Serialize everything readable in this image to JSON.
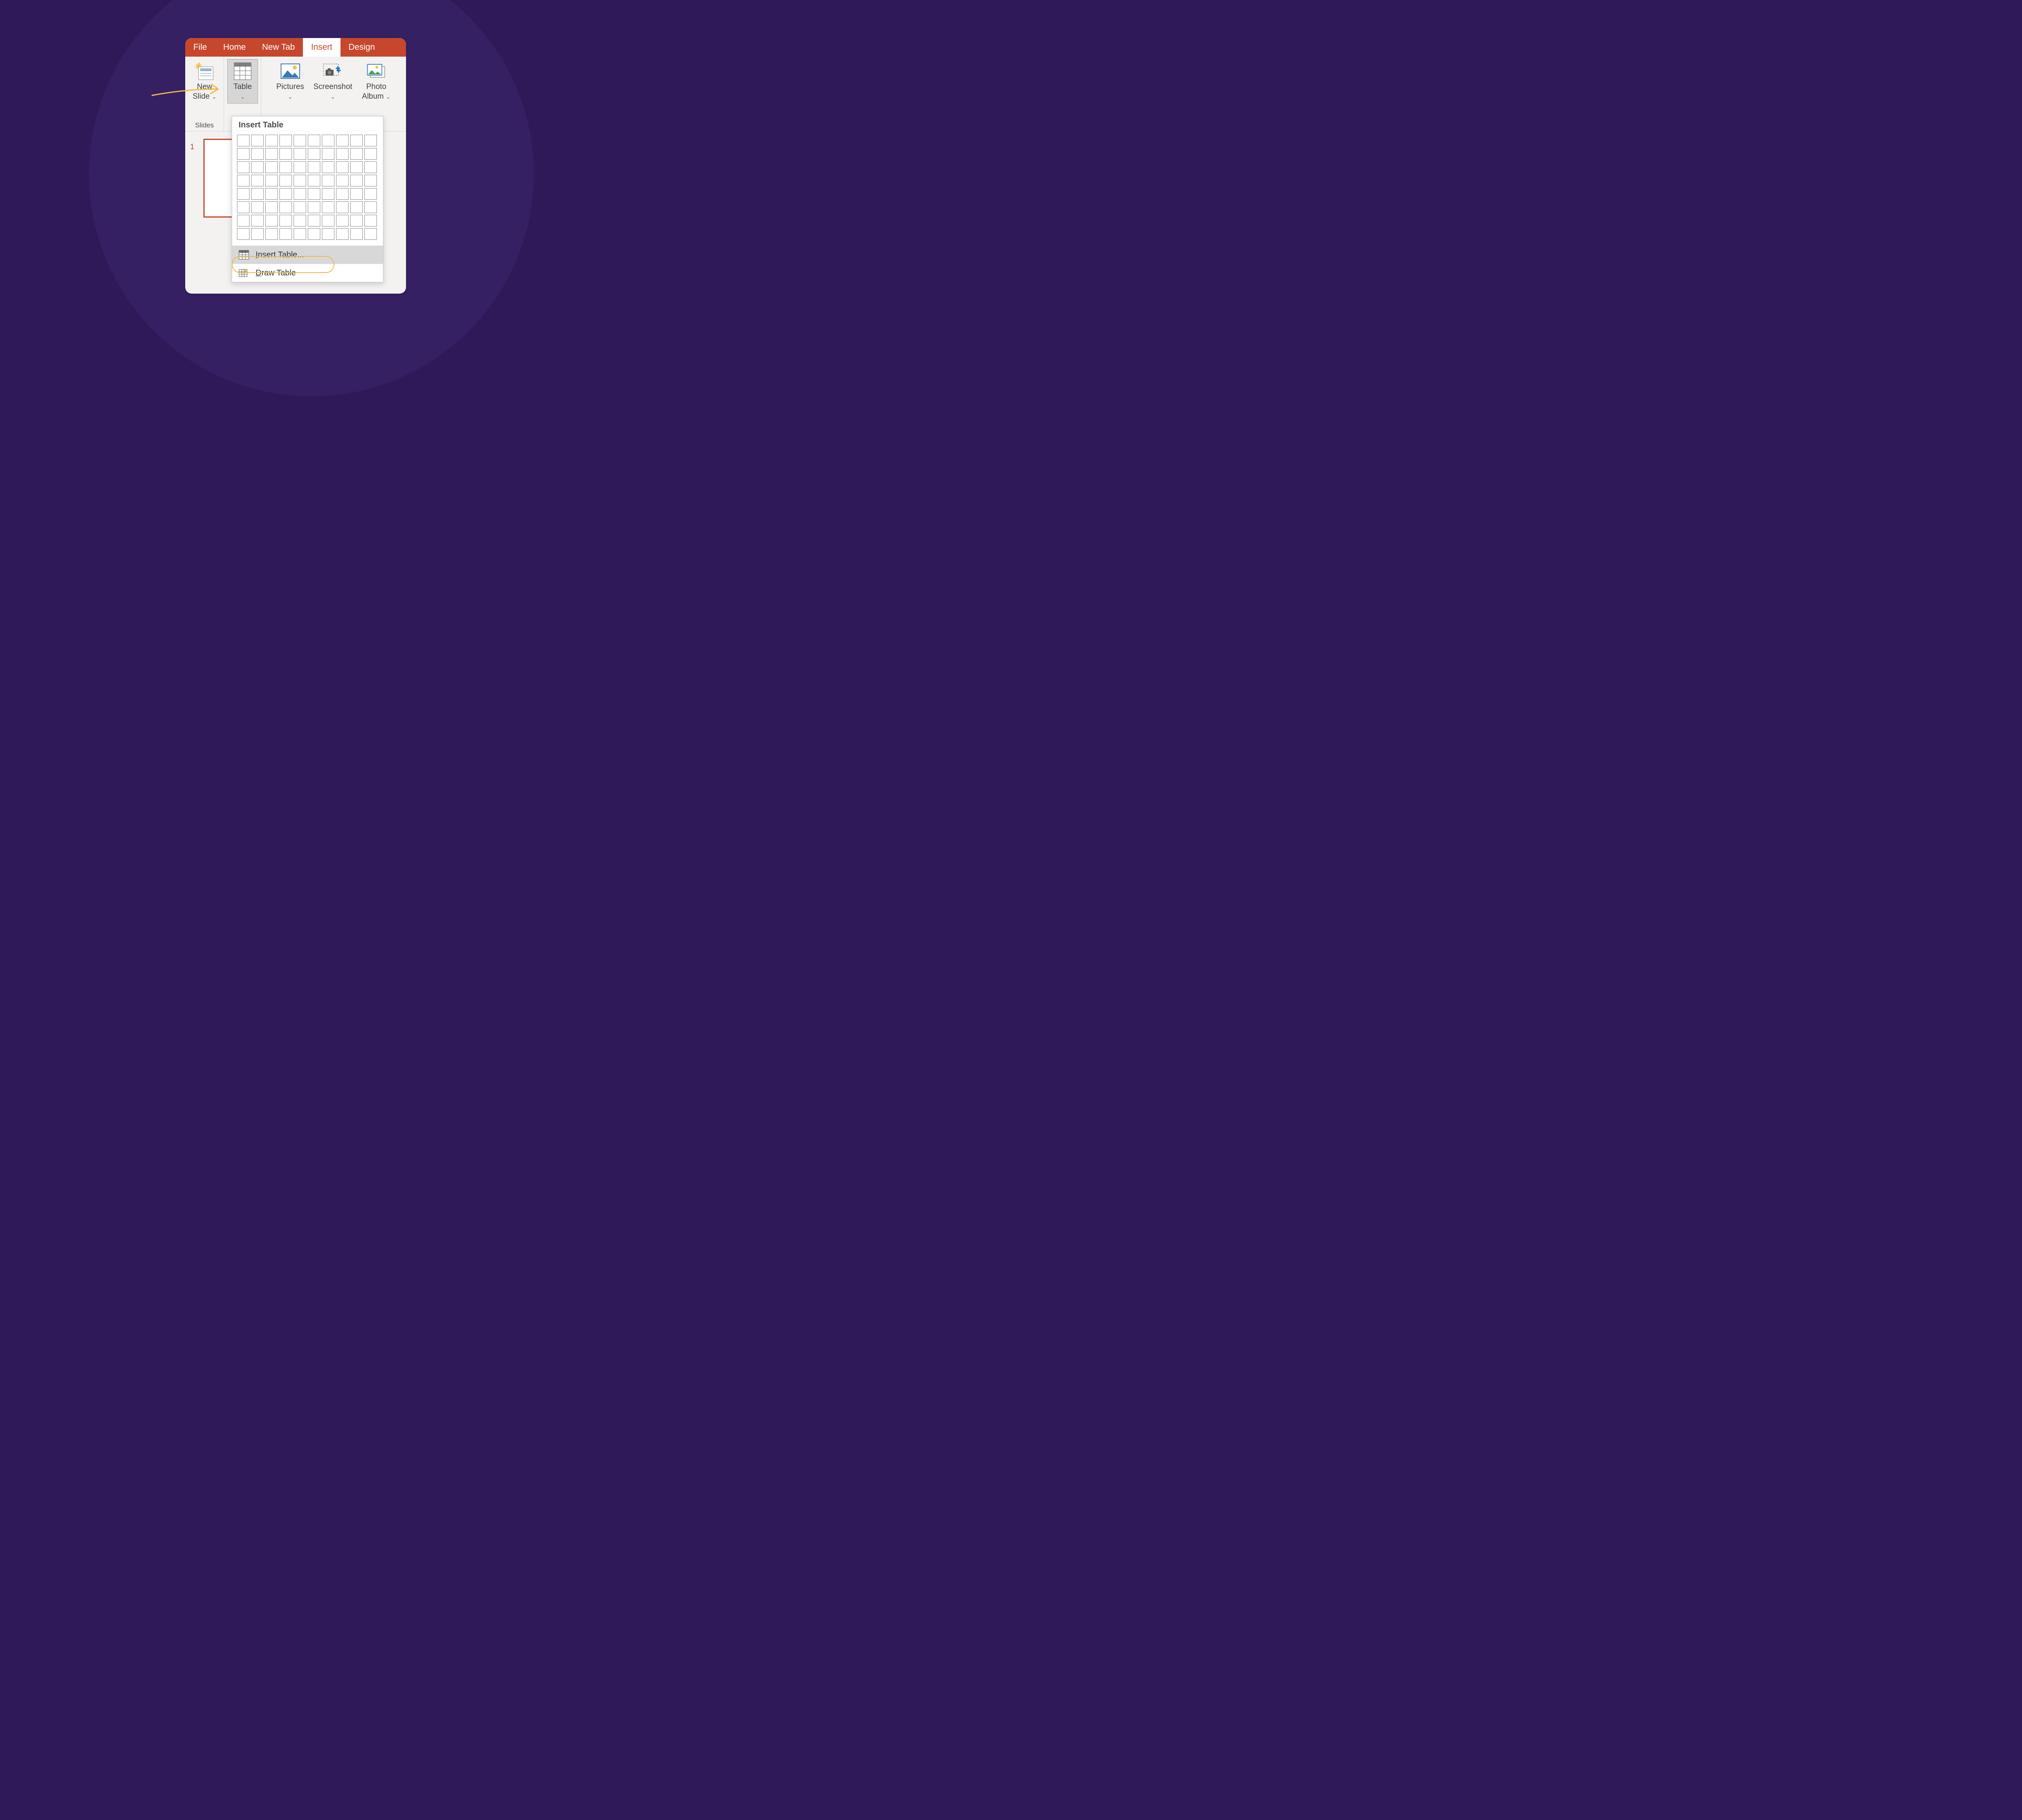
{
  "ribbon": {
    "tabs": [
      "File",
      "Home",
      "New Tab",
      "Insert",
      "Design"
    ],
    "active_tab_index": 3
  },
  "ribbon_groups": {
    "slides": {
      "label": "Slides",
      "new_slide": {
        "line1": "New",
        "line2": "Slide"
      }
    },
    "tables": {
      "table_btn": "Table"
    },
    "images": {
      "pictures_btn": "Pictures",
      "screenshot_btn": "Screenshot",
      "photo_album": {
        "line1": "Photo",
        "line2": "Album"
      }
    }
  },
  "slide_panel": {
    "current_number": "1"
  },
  "table_dropdown": {
    "header": "Insert Table",
    "grid_rows": 8,
    "grid_cols": 10,
    "insert_table_label": "Insert Table...",
    "draw_table_label": "Draw Table"
  }
}
